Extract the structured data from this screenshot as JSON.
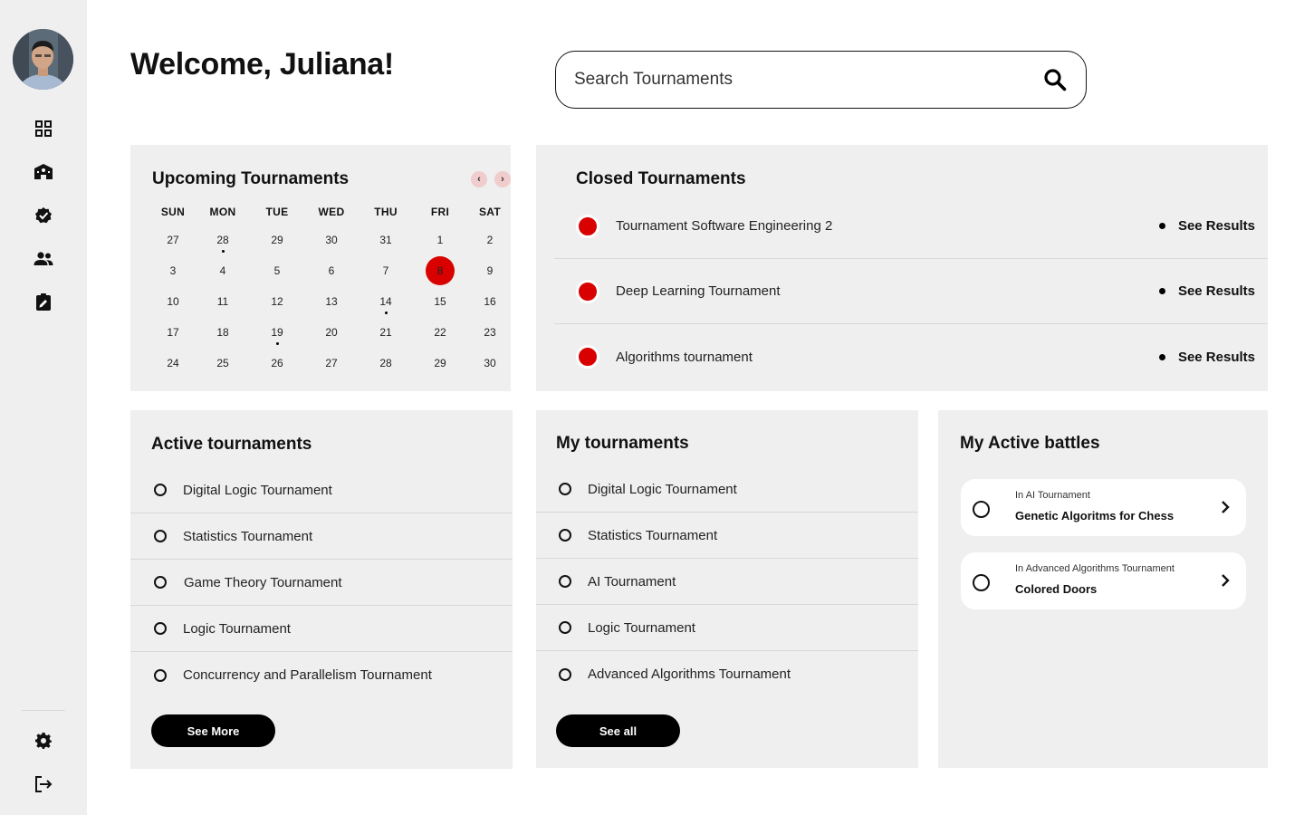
{
  "header": {
    "welcome": "Welcome, Juliana!",
    "search_placeholder": "Search Tournaments"
  },
  "sidebar": {
    "items": [
      {
        "icon": "dashboard-grid-icon",
        "label": "Dashboard"
      },
      {
        "icon": "school-icon",
        "label": "Schools"
      },
      {
        "icon": "verified-badge-icon",
        "label": "Verified"
      },
      {
        "icon": "people-icon",
        "label": "Teams"
      },
      {
        "icon": "assignment-icon",
        "label": "Assignments"
      }
    ],
    "bottom": [
      {
        "icon": "gear-icon",
        "label": "Settings"
      },
      {
        "icon": "logout-icon",
        "label": "Logout"
      }
    ]
  },
  "calendar": {
    "title": "Upcoming Tournaments",
    "weekdays": [
      "SUN",
      "MON",
      "TUE",
      "WED",
      "THU",
      "FRI",
      "SAT"
    ],
    "weeks": [
      [
        27,
        28,
        29,
        30,
        31,
        1,
        2
      ],
      [
        3,
        4,
        5,
        6,
        7,
        8,
        9
      ],
      [
        10,
        11,
        12,
        13,
        14,
        15,
        16
      ],
      [
        17,
        18,
        19,
        20,
        21,
        22,
        23
      ],
      [
        24,
        25,
        26,
        27,
        28,
        29,
        30
      ]
    ],
    "today": {
      "week": 1,
      "day": 5
    },
    "events": [
      {
        "week": 0,
        "day": 1
      },
      {
        "week": 2,
        "day": 4
      },
      {
        "week": 3,
        "day": 2
      }
    ]
  },
  "closed": {
    "title": "Closed Tournaments",
    "action_label": "See Results",
    "items": [
      "Tournament Software Engineering 2",
      "Deep Learning Tournament",
      "Algorithms tournament"
    ]
  },
  "active": {
    "title": "Active tournaments",
    "items": [
      "Digital Logic Tournament",
      "Statistics Tournament",
      "Game Theory Tournament",
      "Logic Tournament",
      "Concurrency and Parallelism Tournament"
    ],
    "button": "See More"
  },
  "mine": {
    "title": "My tournaments",
    "items": [
      "Digital Logic Tournament",
      "Statistics Tournament",
      "AI Tournament",
      "Logic Tournament",
      "Advanced Algorithms Tournament"
    ],
    "button": "See all"
  },
  "battles": {
    "title": "My Active battles",
    "items": [
      {
        "sub": "In AI Tournament",
        "name": "Genetic Algoritms for Chess"
      },
      {
        "sub": "In Advanced Algorithms Tournament",
        "name": "Colored Doors"
      }
    ]
  },
  "colors": {
    "accent_red": "#d90000",
    "card_bg": "#efefef",
    "nav_pink": "#f0cccc"
  }
}
